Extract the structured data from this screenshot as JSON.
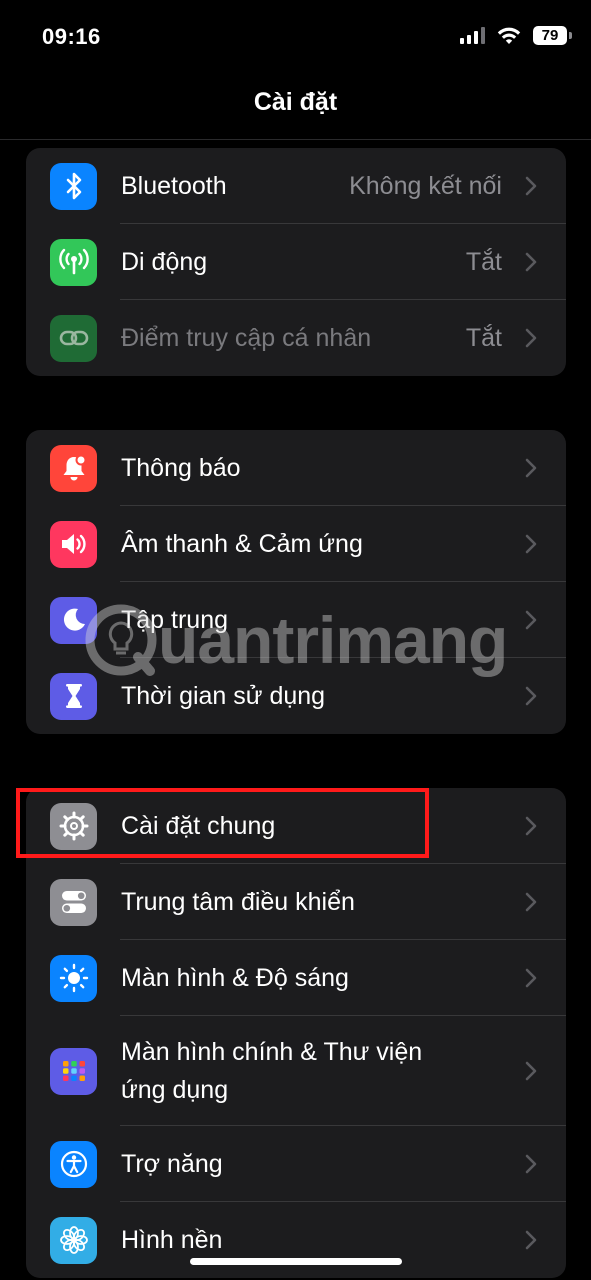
{
  "status_bar": {
    "time": "09:16",
    "battery": "79"
  },
  "header": {
    "title": "Cài đặt"
  },
  "groups": [
    {
      "items": [
        {
          "label": "Bluetooth",
          "value": "Không kết nối",
          "icon": "bluetooth-icon",
          "color": "#0a84ff"
        },
        {
          "label": "Di động",
          "value": "Tắt",
          "icon": "antenna-icon",
          "color": "#32c759"
        },
        {
          "label": "Điểm truy cập cá nhân",
          "value": "Tắt",
          "icon": "link-icon",
          "color": "#1f6b35"
        }
      ]
    },
    {
      "items": [
        {
          "label": "Thông báo",
          "icon": "bell-icon",
          "color": "#ff453a"
        },
        {
          "label": "Âm thanh & Cảm ứng",
          "icon": "speaker-icon",
          "color": "#ff375f"
        },
        {
          "label": "Tập trung",
          "icon": "moon-icon",
          "color": "#5e5ce6"
        },
        {
          "label": "Thời gian sử dụng",
          "icon": "hourglass-icon",
          "color": "#5e5ce6"
        }
      ]
    },
    {
      "items": [
        {
          "label": "Cài đặt chung",
          "icon": "gear-icon",
          "color": "#8e8e93"
        },
        {
          "label": "Trung tâm điều khiển",
          "icon": "toggles-icon",
          "color": "#8e8e93"
        },
        {
          "label": "Màn hình & Độ sáng",
          "icon": "sun-icon",
          "color": "#0a84ff"
        },
        {
          "label_line1": "Màn hình chính & Thư viện",
          "label_line2": "ứng dụng",
          "icon": "app-grid-icon",
          "color": "#5e5ce6"
        },
        {
          "label": "Trợ năng",
          "icon": "accessibility-icon",
          "color": "#0a84ff"
        },
        {
          "label": "Hình nền",
          "icon": "flower-icon",
          "color": "#32ade6"
        }
      ]
    }
  ],
  "watermark": {
    "text": "uantrimang"
  }
}
